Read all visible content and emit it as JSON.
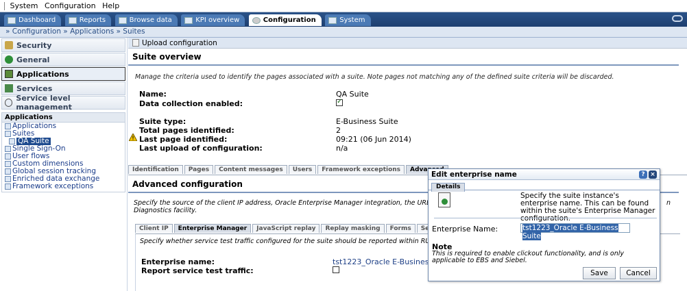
{
  "menubar": {
    "items": [
      "System",
      "Configuration",
      "Help"
    ]
  },
  "tabs": [
    {
      "label": "Dashboard",
      "icon": "dashboard-icon"
    },
    {
      "label": "Reports",
      "icon": "reports-icon"
    },
    {
      "label": "Browse data",
      "icon": "browse-icon"
    },
    {
      "label": "KPI overview",
      "icon": "kpi-icon"
    },
    {
      "label": "Configuration",
      "icon": "gear-icon",
      "active": true
    },
    {
      "label": "System",
      "icon": "system-icon"
    }
  ],
  "breadcrumb": "» Configuration » Applications » Suites",
  "sidebar": {
    "sections": [
      {
        "label": "Security",
        "icon": "security-icon"
      },
      {
        "label": "General",
        "icon": "general-icon"
      },
      {
        "label": "Applications",
        "icon": "applications-icon",
        "selected": true
      },
      {
        "label": "Services",
        "icon": "services-icon"
      },
      {
        "label": "Service level management",
        "icon": "slm-icon"
      }
    ],
    "tree_header": "Applications",
    "tree": [
      {
        "label": "Applications",
        "level": 0
      },
      {
        "label": "Suites",
        "level": 0
      },
      {
        "label": "QA Suite",
        "level": 1,
        "selected": true
      },
      {
        "label": "Single Sign-On",
        "level": 0
      },
      {
        "label": "User flows",
        "level": 0
      },
      {
        "label": "Custom dimensions",
        "level": 0
      },
      {
        "label": "Global session tracking",
        "level": 0
      },
      {
        "label": "Enriched data exchange",
        "level": 0
      },
      {
        "label": "Framework exceptions",
        "level": 0
      }
    ]
  },
  "main": {
    "upload_label": "Upload configuration",
    "title": "Suite overview",
    "description": "Manage the criteria used to identify the pages associated with a suite. Note pages not matching any of the defined suite criteria will be discarded.",
    "fields": {
      "name_label": "Name:",
      "name_value": "QA Suite",
      "collection_label": "Data collection enabled:",
      "collection_checked": true,
      "type_label": "Suite type:",
      "type_value": "E-Business Suite",
      "total_label": "Total pages identified:",
      "total_value": "2",
      "last_page_label": "Last page identified:",
      "last_page_value": "09:21 (06 Jun 2014)",
      "last_upload_label": "Last upload of configuration:",
      "last_upload_value": "n/a"
    },
    "tabs": [
      "Identification",
      "Pages",
      "Content messages",
      "Users",
      "Framework exceptions",
      "Advanced"
    ],
    "active_tab": "Advanced",
    "advanced": {
      "title": "Advanced configuration",
      "description_left": "Specify the source of the client IP address, Oracle Enterprise Manager integration, the URL diagnostics r",
      "description_right": "n",
      "description_line2": "Diagnostics facility.",
      "subtabs": [
        "Client IP",
        "Enterprise Manager",
        "JavaScript replay",
        "Replay masking",
        "Forms",
        "Session tracking"
      ],
      "active_subtab": "Enterprise Manager",
      "em_description": "Specify whether service test traffic configured for the suite should be reported within RUEI and the Ente",
      "enterprise_label": "Enterprise name:",
      "enterprise_value": "tst1223_Oracle E-Business Su",
      "report_label": "Report service test traffic:",
      "report_checked": false
    }
  },
  "dialog": {
    "title": "Edit enterprise name",
    "tab": "Details",
    "info": "Specify the suite instance's enterprise name. This can be found within the suite's Enterprise Manager configuration.",
    "field_label": "Enterprise Name:",
    "field_value": "tst1223_Oracle E-Business Suite",
    "note_title": "Note",
    "note_text": "This is required to enable clickout functionality, and is only applicable to EBS and Siebel.",
    "save_label": "Save",
    "cancel_label": "Cancel"
  }
}
